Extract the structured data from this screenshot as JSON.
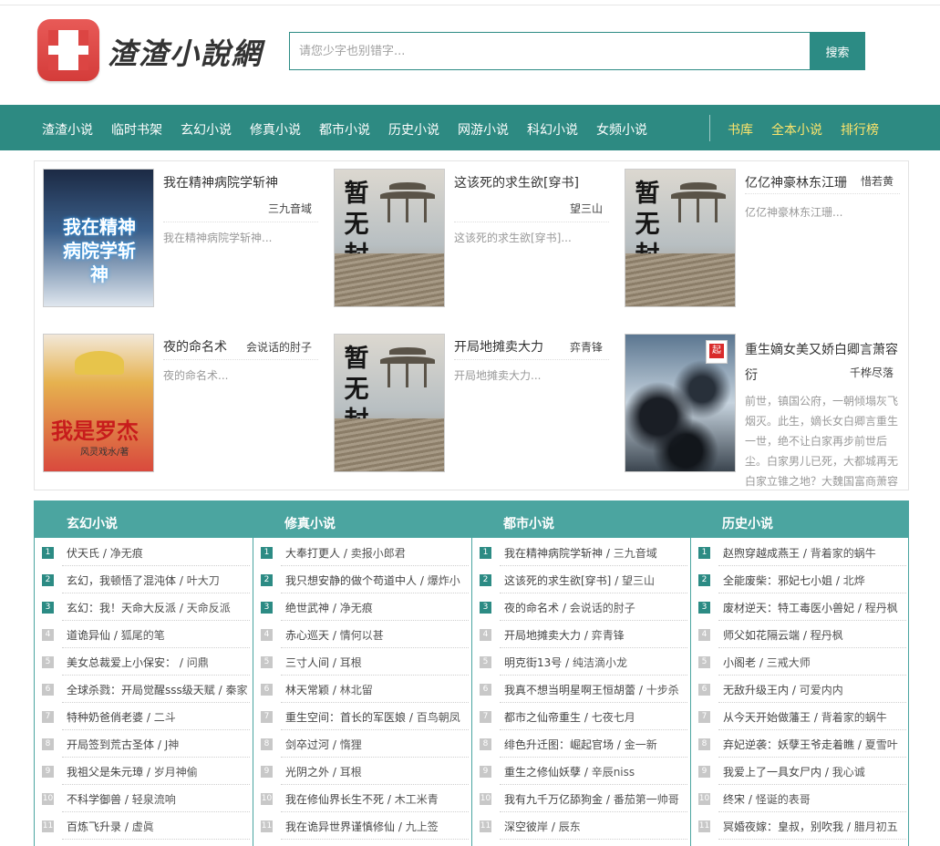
{
  "header": {
    "site_title": "渣渣小說網",
    "search_placeholder": "请您少字也别错字...",
    "search_button": "搜索"
  },
  "nav": {
    "left": [
      "渣渣小说",
      "临时书架",
      "玄幻小说",
      "修真小说",
      "都市小说",
      "历史小说",
      "网游小说",
      "科幻小说",
      "女频小说"
    ],
    "right": [
      "书库",
      "全本小说",
      "排行榜"
    ]
  },
  "featured": [
    {
      "title": "我在精神病院学斩神",
      "author": "三九音域",
      "desc": "我在精神病院学斩神...",
      "cover_icon": "cover-image",
      "cover_text": "我在精神病院学斩神"
    },
    {
      "title": "这该死的求生欲[穿书]",
      "author": "望三山",
      "desc": "这该死的求生欲[穿书]...",
      "cover_icon": "no-cover-image",
      "cover_text": "暂无封面"
    },
    {
      "title": "亿亿神豪林东江珊",
      "author": "惜若黄",
      "desc": "亿亿神豪林东江珊...",
      "cover_icon": "no-cover-image",
      "cover_text": "暂无封面"
    },
    {
      "title": "夜的命名术",
      "author": "会说话的肘子",
      "desc": "夜的命名术...",
      "cover_icon": "cover-image",
      "cover_text": "我是罗杰"
    },
    {
      "title": "开局地摊卖大力",
      "author": "弈青锋",
      "desc": "开局地摊卖大力...",
      "cover_icon": "no-cover-image",
      "cover_text": "暂无封面"
    },
    {
      "title": "重生嫡女美又娇白卿言萧容衍",
      "author": "千桦尽落",
      "desc": "前世，镇国公府，一朝倾塌灰飞烟灭。此生，嫡长女白卿言重生一世，绝不让白家再步前世后尘。白家男儿已死，大都城再无白家立锥之地？大魏国富商萧容",
      "cover_icon": "cover-image",
      "cover_text": ""
    }
  ],
  "cover_texts": {
    "pirate_title": "我是罗杰",
    "pirate_sub": "风灵戏水/著",
    "spirit_title": "我在精神病院学斩神",
    "nocover": "暂无封面",
    "badge": "起"
  },
  "ranking": {
    "columns": [
      {
        "name": "玄幻小说",
        "items": [
          {
            "title": "伏天氏",
            "author": "净无痕"
          },
          {
            "title": "玄幻，我顿悟了混沌体",
            "author": "叶大刀"
          },
          {
            "title": "玄幻：我！天命大反派",
            "author": "天命反派"
          },
          {
            "title": "道诡异仙",
            "author": "狐尾的笔"
          },
          {
            "title": "美女总裁爱上小保安：",
            "author": "问鼎"
          },
          {
            "title": "全球杀戮：开局觉醒sss级天赋",
            "author": "秦家"
          },
          {
            "title": "特种奶爸俏老婆",
            "author": "二斗"
          },
          {
            "title": "开局签到荒古圣体",
            "author": "J神"
          },
          {
            "title": "我祖父是朱元璋",
            "author": "岁月神偷"
          },
          {
            "title": "不科学御兽",
            "author": "轻泉流响"
          },
          {
            "title": "百炼飞升录",
            "author": "虚眞"
          }
        ]
      },
      {
        "name": "修真小说",
        "items": [
          {
            "title": "大奉打更人",
            "author": "卖报小郎君"
          },
          {
            "title": "我只想安静的做个苟道中人",
            "author": "爆炸小"
          },
          {
            "title": "绝世武神",
            "author": "净无痕"
          },
          {
            "title": "赤心巡天",
            "author": "情何以甚"
          },
          {
            "title": "三寸人间",
            "author": "耳根"
          },
          {
            "title": "林天常颖",
            "author": "林北留"
          },
          {
            "title": "重生空间：首长的军医娘",
            "author": "百鸟朝凤"
          },
          {
            "title": "剑卒过河",
            "author": "惰狸"
          },
          {
            "title": "光阴之外",
            "author": "耳根"
          },
          {
            "title": "我在修仙界长生不死",
            "author": "木工米青"
          },
          {
            "title": "我在诡异世界谨慎修仙",
            "author": "九上签"
          }
        ]
      },
      {
        "name": "都市小说",
        "items": [
          {
            "title": "我在精神病院学斩神",
            "author": "三九音域"
          },
          {
            "title": "这该死的求生欲[穿书]",
            "author": "望三山"
          },
          {
            "title": "夜的命名术",
            "author": "会说话的肘子"
          },
          {
            "title": "开局地摊卖大力",
            "author": "弈青锋"
          },
          {
            "title": "明克街13号",
            "author": "纯洁滴小龙"
          },
          {
            "title": "我真不想当明星啊王恒胡蕾",
            "author": "十步杀"
          },
          {
            "title": "都市之仙帝重生",
            "author": "七夜七月"
          },
          {
            "title": "绯色升迁图：崛起官场",
            "author": "金一新"
          },
          {
            "title": "重生之修仙妖孽",
            "author": "辛辰niss"
          },
          {
            "title": "我有九千万亿舔狗金",
            "author": "番茄第一帅哥"
          },
          {
            "title": "深空彼岸",
            "author": "辰东"
          }
        ]
      },
      {
        "name": "历史小说",
        "items": [
          {
            "title": "赵煦穿越成燕王",
            "author": "背着家的蜗牛"
          },
          {
            "title": "全能废柴：邪妃七小姐",
            "author": "北烨"
          },
          {
            "title": "废材逆天：特工毒医小兽妃",
            "author": "程丹枫"
          },
          {
            "title": "师父如花隔云端",
            "author": "程丹枫"
          },
          {
            "title": "小阁老",
            "author": "三戒大师"
          },
          {
            "title": "无敌升级王内",
            "author": "可爱内内"
          },
          {
            "title": "从今天开始做藩王",
            "author": "背着家的蜗牛"
          },
          {
            "title": "弃妃逆袭：妖孽王爷走着瞧",
            "author": "夏雪叶"
          },
          {
            "title": "我爱上了一具女尸内",
            "author": "我心诚"
          },
          {
            "title": "终宋",
            "author": "怪诞的表哥"
          },
          {
            "title": "冥婚夜嫁：皇叔，别吹我",
            "author": "腊月初五"
          }
        ]
      }
    ]
  }
}
